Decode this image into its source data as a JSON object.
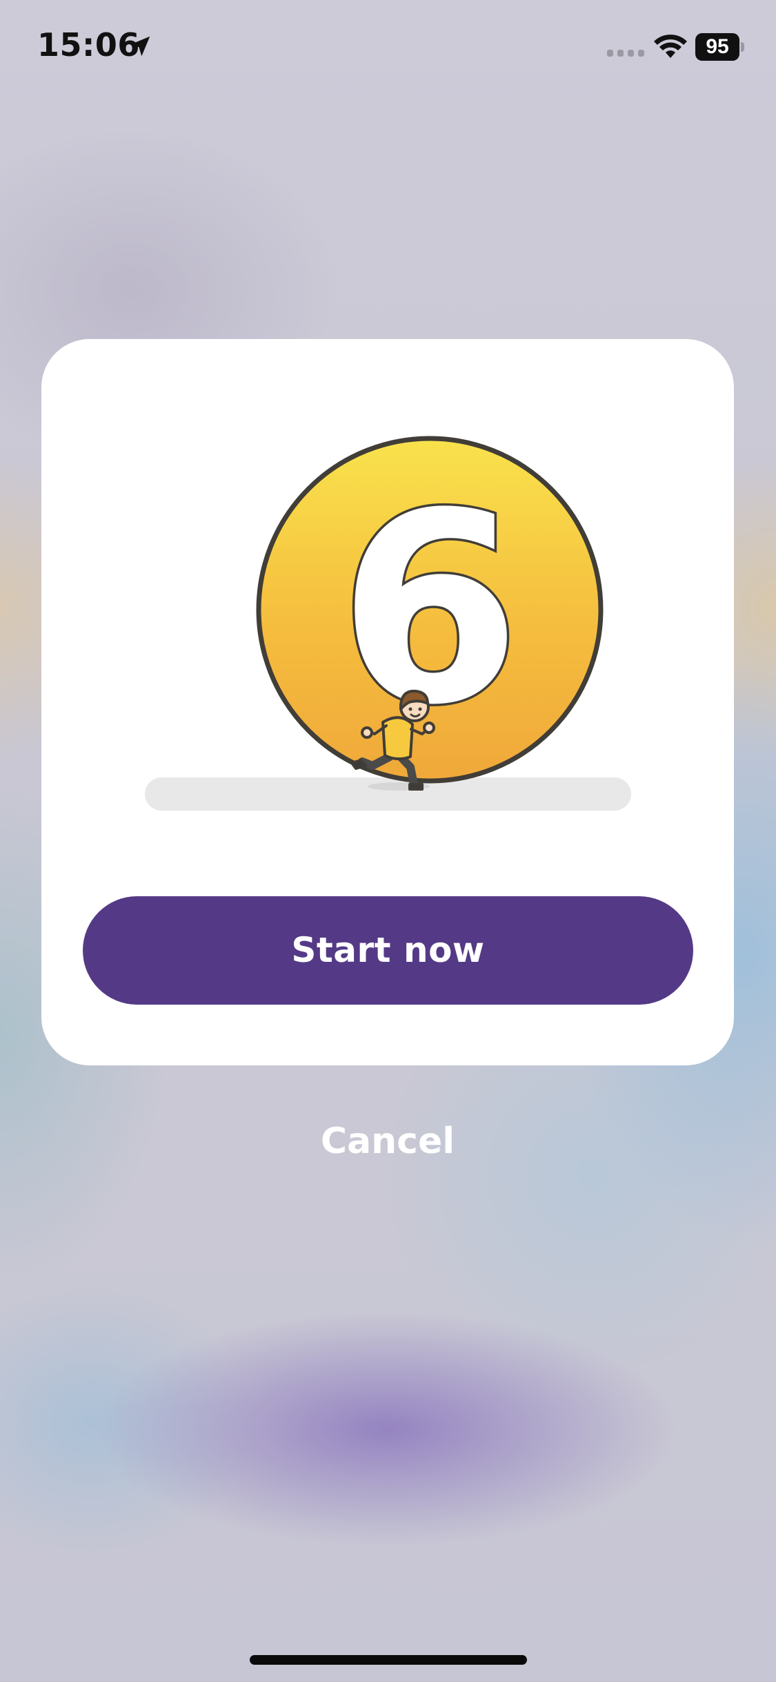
{
  "status_bar": {
    "time": "15:06",
    "battery_level": "95",
    "icons": [
      "location-arrow-icon",
      "cellular-signal-icon",
      "wifi-icon",
      "battery-icon"
    ]
  },
  "modal": {
    "badge_number": "6",
    "illustration": "running-person-with-number-badge",
    "start_button_label": "Start now"
  },
  "cancel_label": "Cancel",
  "colors": {
    "primary_button": "#543a86",
    "badge_yellow_top": "#f9e24c",
    "badge_yellow_bottom": "#f0a83a",
    "card_background": "#ffffff"
  }
}
